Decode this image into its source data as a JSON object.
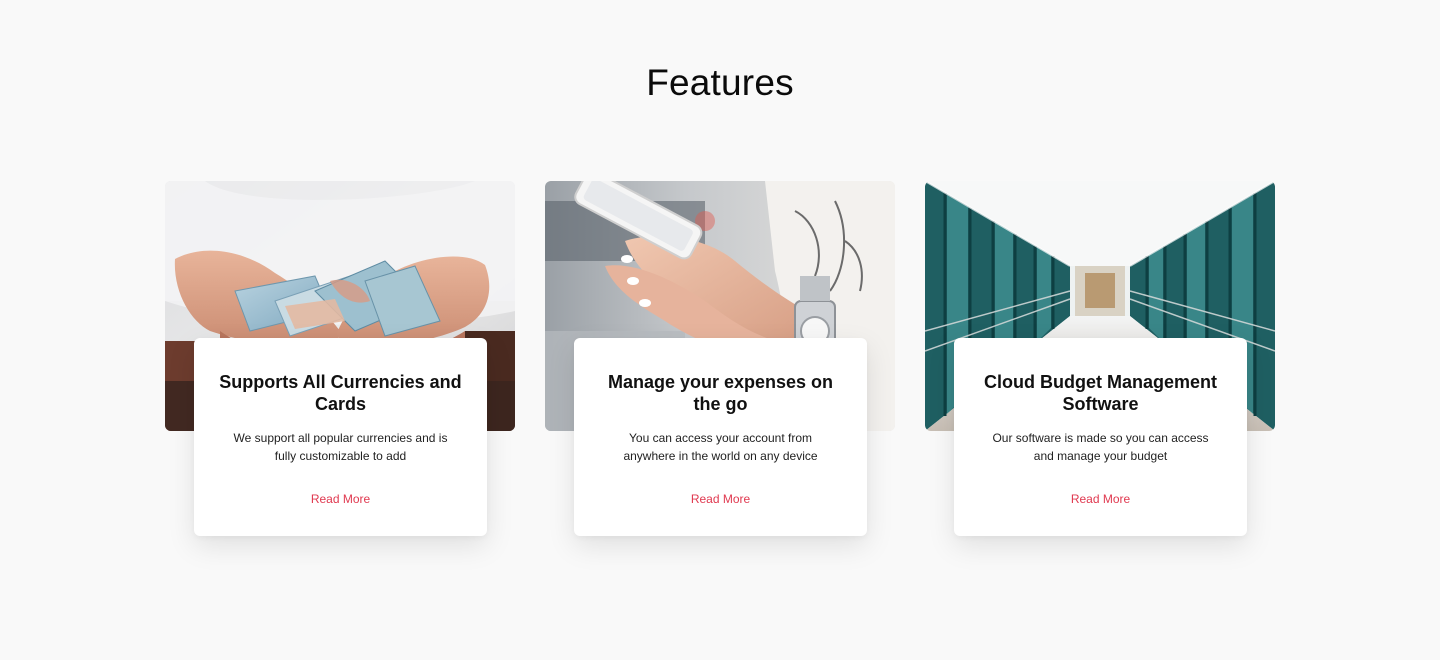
{
  "page": {
    "title": "Features"
  },
  "features": [
    {
      "image": "hands-holding-euro-banknotes-photo",
      "heading": "Supports All Currencies and Cards",
      "description": "We support all popular currencies and is fully customizable to add",
      "link_label": "Read More"
    },
    {
      "image": "hands-holding-smartphone-photo",
      "heading": "Manage your expenses on the go",
      "description": "You can access your account from anywhere in the world on any device",
      "link_label": "Read More"
    },
    {
      "image": "glass-corridor-building-photo",
      "heading": "Cloud Budget Management Software",
      "description": "Our software is made so you can access and manage your budget",
      "link_label": "Read More"
    }
  ],
  "colors": {
    "background": "#f9f9f9",
    "card": "#ffffff",
    "accent_link": "#e0384f",
    "text": "#111111"
  }
}
